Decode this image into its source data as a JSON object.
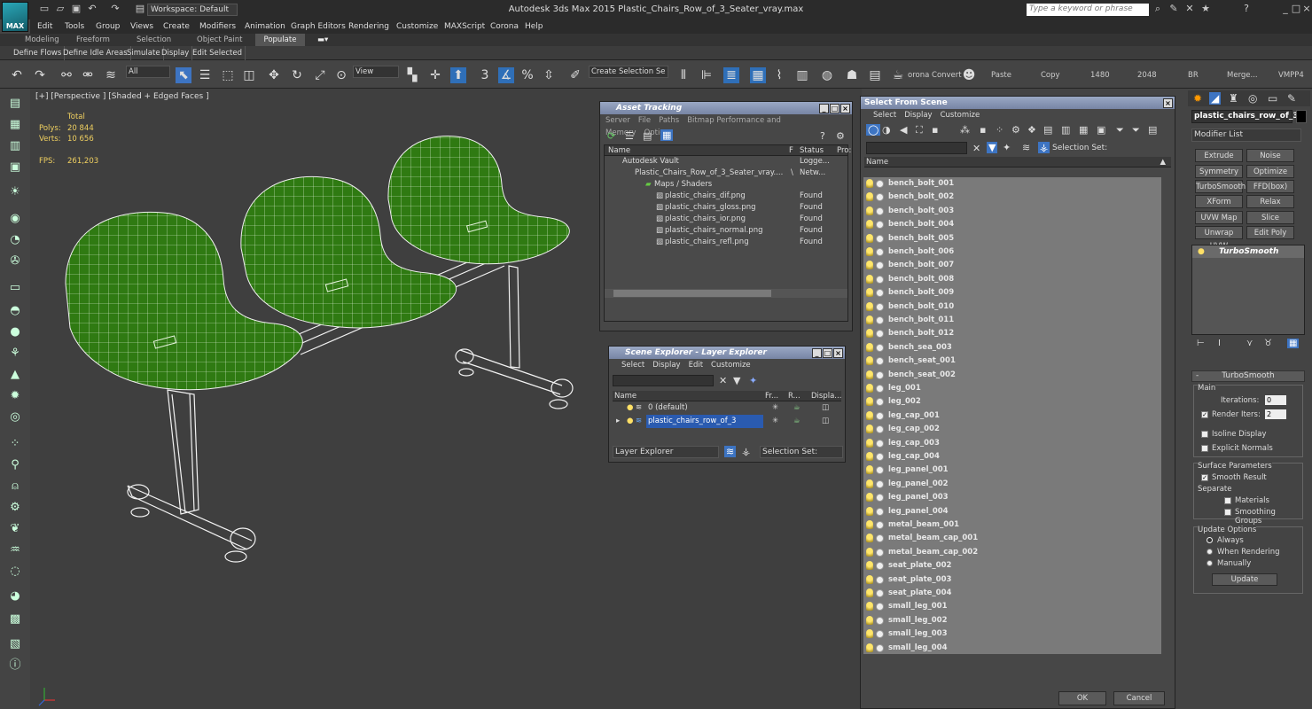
{
  "title_bar": {
    "app_badge": "MAX",
    "workspace": "Workspace: Default",
    "app_title": "Autodesk 3ds Max  2015     Plastic_Chairs_Row_of_3_Seater_vray.max",
    "search_placeholder": "Type a keyword or phrase"
  },
  "menu": [
    "Edit",
    "Tools",
    "Group",
    "Views",
    "Create",
    "Modifiers",
    "Animation",
    "Graph Editors",
    "Rendering",
    "Customize",
    "MAXScript",
    "Corona",
    "Help"
  ],
  "ribbon_tabs": [
    "Modeling",
    "Freeform",
    "Selection",
    "Object Paint",
    "Populate"
  ],
  "ribbon_row2": [
    "Define Flows",
    "Define Idle Areas",
    "Simulate",
    "Display",
    "Edit Selected"
  ],
  "toolbar": {
    "filter": "All",
    "ref_coord": "View",
    "selection_set": "Create Selection Se",
    "labels": [
      "orona Convert",
      "Paste",
      "Copy",
      "1480",
      "2048",
      "BR",
      "Merge...",
      "VMPP4"
    ]
  },
  "viewport": {
    "label": "[+] [Perspective ] [Shaded + Edged Faces ]",
    "stats_header": "Total",
    "polys_label": "Polys:",
    "polys_value": "20 844",
    "verts_label": "Verts:",
    "verts_value": "10 656",
    "fps_label": "FPS:",
    "fps_value": "261,203"
  },
  "asset_tracking": {
    "title": "Asset Tracking",
    "menu": [
      "Server",
      "File",
      "Paths",
      "Bitmap Performance and Memory",
      "Options"
    ],
    "columns": [
      "Name",
      "F",
      "Status",
      "Pro:"
    ],
    "rows": [
      {
        "name": "Autodesk Vault",
        "status": "Logge..."
      },
      {
        "name": "Plastic_Chairs_Row_of_3_Seater_vray....",
        "f": "\\",
        "status": "Netw..."
      },
      {
        "name": "Maps / Shaders",
        "status": ""
      },
      {
        "name": "plastic_chairs_dif.png",
        "status": "Found"
      },
      {
        "name": "plastic_chairs_gloss.png",
        "status": "Found"
      },
      {
        "name": "plastic_chairs_ior.png",
        "status": "Found"
      },
      {
        "name": "plastic_chairs_normal.png",
        "status": "Found"
      },
      {
        "name": "plastic_chairs_refl.png",
        "status": "Found"
      }
    ]
  },
  "scene_explorer": {
    "title": "Scene Explorer - Layer Explorer",
    "menu": [
      "Select",
      "Display",
      "Edit",
      "Customize"
    ],
    "columns": [
      "Name",
      "Fr...",
      "R...",
      "Displa..."
    ],
    "rows": [
      {
        "name": "0 (default)"
      },
      {
        "name": "plastic_chairs_row_of_3"
      }
    ],
    "footer_dropdown": "Layer Explorer",
    "selection_set": "Selection Set:"
  },
  "select_from_scene": {
    "title": "Select From Scene",
    "menu": [
      "Select",
      "Display",
      "Customize"
    ],
    "selection_set": "Selection Set:",
    "column": "Name",
    "items": [
      "bench_bolt_001",
      "bench_bolt_002",
      "bench_bolt_003",
      "bench_bolt_004",
      "bench_bolt_005",
      "bench_bolt_006",
      "bench_bolt_007",
      "bench_bolt_008",
      "bench_bolt_009",
      "bench_bolt_010",
      "bench_bolt_011",
      "bench_bolt_012",
      "bench_sea_003",
      "bench_seat_001",
      "bench_seat_002",
      "leg_001",
      "leg_002",
      "leg_cap_001",
      "leg_cap_002",
      "leg_cap_003",
      "leg_cap_004",
      "leg_panel_001",
      "leg_panel_002",
      "leg_panel_003",
      "leg_panel_004",
      "metal_beam_001",
      "metal_beam_cap_001",
      "metal_beam_cap_002",
      "seat_plate_002",
      "seat_plate_003",
      "seat_plate_004",
      "small_leg_001",
      "small_leg_002",
      "small_leg_003",
      "small_leg_004"
    ],
    "ok": "OK",
    "cancel": "Cancel"
  },
  "command_panel": {
    "object_name": "plastic_chairs_row_of_3",
    "modifier_list": "Modifier List",
    "buttons": [
      "Extrude",
      "Noise",
      "Symmetry",
      "Optimize",
      "TurboSmooth",
      "FFD(box)",
      "XForm",
      "Relax",
      "UVW Map",
      "Slice",
      "Unwrap UVW",
      "Edit Poly"
    ],
    "stack_item": "TurboSmooth",
    "rollout_title": "TurboSmooth",
    "main": "Main",
    "iterations_label": "Iterations:",
    "iterations": "0",
    "render_iters_label": "Render Iters:",
    "render_iters": "2",
    "isoline": "Isoline Display",
    "explicit": "Explicit Normals",
    "surface": "Surface Parameters",
    "smooth_result": "Smooth Result",
    "separate": "Separate",
    "materials": "Materials",
    "smoothing_groups": "Smoothing Groups",
    "update_options": "Update Options",
    "always": "Always",
    "when_rendering": "When Rendering",
    "manually": "Manually",
    "update": "Update"
  },
  "colors": {
    "seat_green": "#2f7a12",
    "wire": "#ffffff",
    "title_blue": "#8593b3"
  }
}
